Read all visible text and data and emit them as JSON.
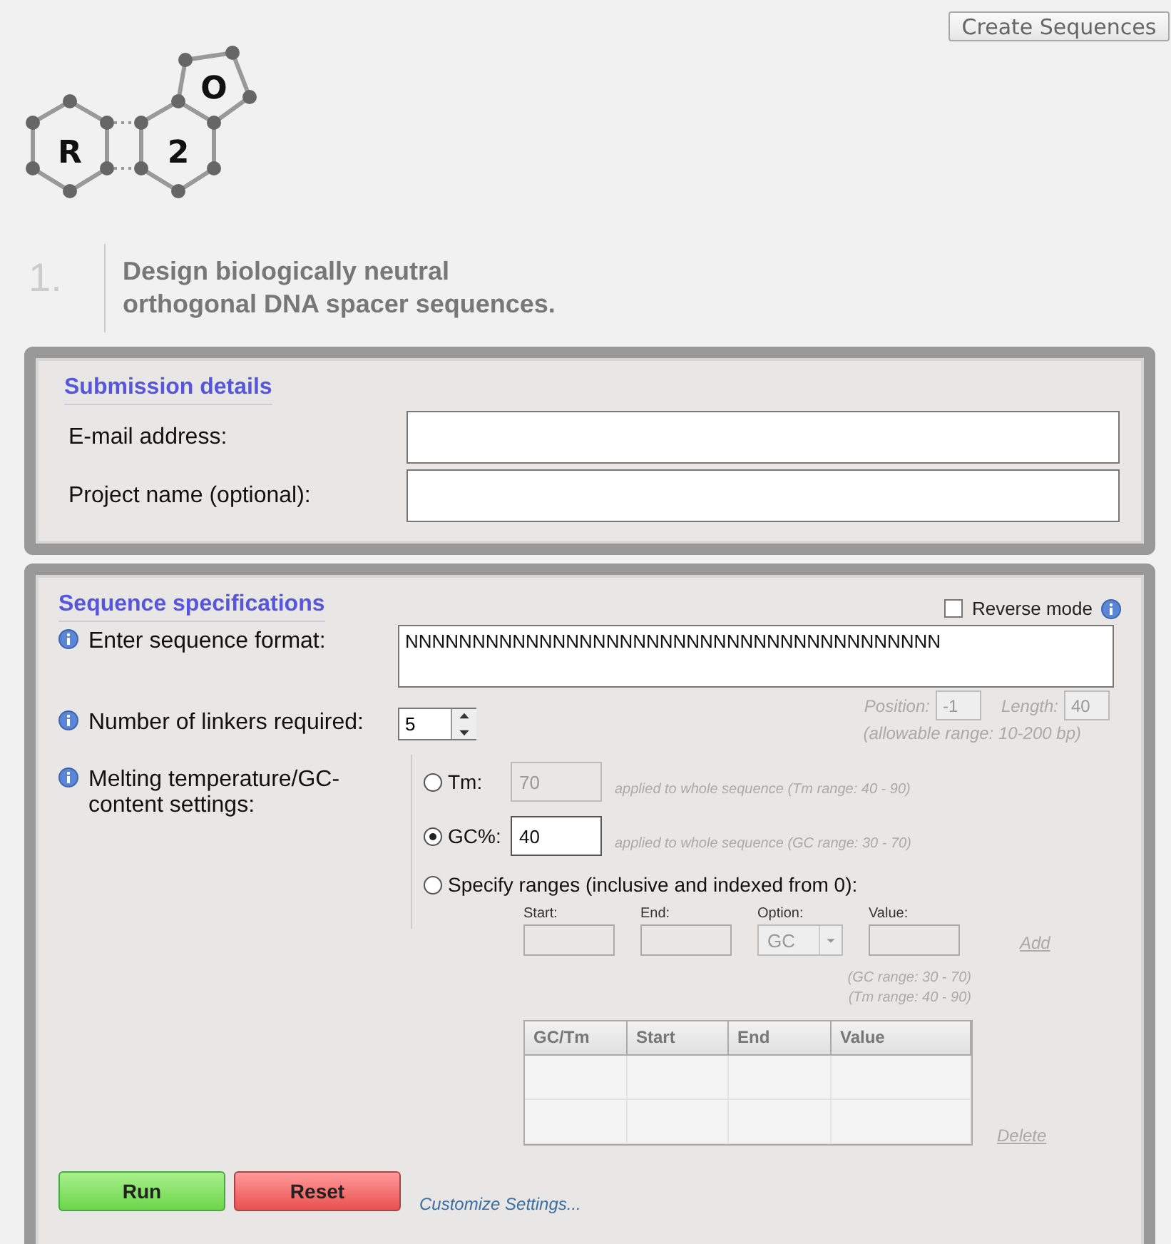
{
  "header_button": "Create Sequences",
  "logo": {
    "letters": [
      "R",
      "2",
      "O"
    ]
  },
  "step": {
    "number": "1.",
    "title": "Design biologically neutral orthogonal DNA spacer sequences."
  },
  "submission": {
    "title": "Submission details",
    "fields": [
      {
        "label": "E-mail address:"
      },
      {
        "label": "Project name (optional):"
      }
    ]
  },
  "specs": {
    "title": "Sequence specifications",
    "reverse_mode": {
      "label": "Reverse mode",
      "checked": false
    },
    "format": {
      "label": "Enter sequence format:",
      "value": "NNNNNNNNNNNNNNNNNNNNNNNNNNNNNNNNNNNNNNNN"
    },
    "position": {
      "label": "Position:",
      "value": "-1"
    },
    "length": {
      "label": "Length:",
      "value": "40"
    },
    "allowable": "(allowable range: 10-200 bp)",
    "linkers": {
      "label": "Number of linkers required:",
      "value": "5"
    },
    "melting": {
      "label": "Melting temperature/GC-content settings:",
      "options": [
        {
          "label": "Tm:",
          "value": "70",
          "note": "applied to whole sequence (Tm range: 40 - 90)",
          "selected": false
        },
        {
          "label": "GC%:",
          "value": "40",
          "note": "applied to whole sequence (GC range: 30 - 70)",
          "selected": true
        },
        {
          "label": "Specify ranges (inclusive and indexed from 0):",
          "selected": false
        }
      ]
    },
    "range_inputs": [
      {
        "label": "Start:",
        "kind": "input"
      },
      {
        "label": "End:",
        "kind": "input"
      },
      {
        "label": "Option:",
        "kind": "select",
        "value": "GC"
      },
      {
        "label": "Value:",
        "kind": "input"
      }
    ],
    "add_link": "Add",
    "range_notes": [
      "(GC range: 30 - 70)",
      "(Tm range: 40 - 90)"
    ],
    "table": {
      "columns": [
        "GC/Tm",
        "Start",
        "End",
        "Value"
      ]
    },
    "delete_link": "Delete"
  },
  "buttons": [
    {
      "label": "Run",
      "kind": "run"
    },
    {
      "label": "Reset",
      "kind": "reset"
    }
  ],
  "customize_link": "Customize Settings..."
}
